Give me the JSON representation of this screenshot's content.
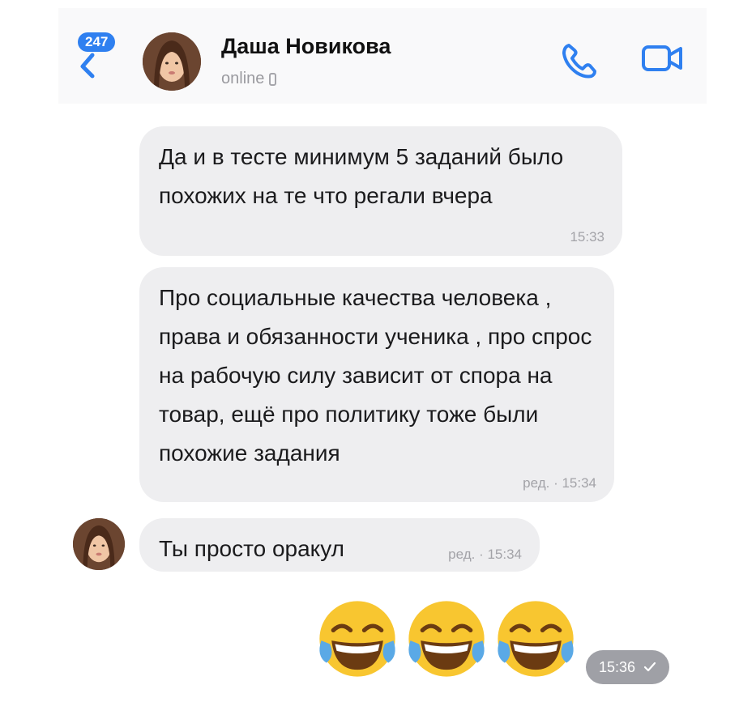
{
  "header": {
    "unread_count": "247",
    "contact_name": "Даша Новикова",
    "status": "online"
  },
  "messages": [
    {
      "text": "Да и в тесте минимум 5 заданий было похожих на те что регали вчера",
      "time": "15:33"
    },
    {
      "text": "Про социальные качества человека , права и обязанности ученика , про спрос на рабочую силу зависит от спора на товар, ещё про политику тоже были похожие задания",
      "time": "ред. · 15:34"
    },
    {
      "text": "Ты просто оракул",
      "time": "ред. · 15:34"
    }
  ],
  "outgoing": {
    "emojis": [
      "face-with-tears-of-joy",
      "face-with-tears-of-joy",
      "face-with-tears-of-joy"
    ],
    "time": "15:36",
    "status_icon": "check-icon"
  },
  "colors": {
    "accent": "#2f80f0",
    "bubble": "#eeeef0",
    "header_bg": "#f9f9fa",
    "time_badge": "#9fa0a6"
  }
}
